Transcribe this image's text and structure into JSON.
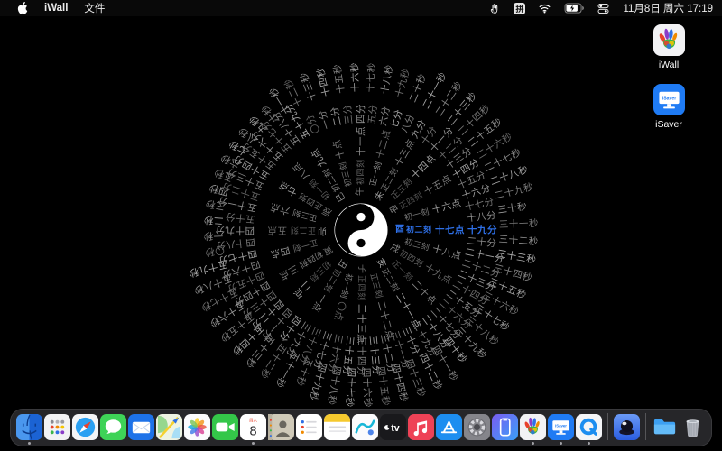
{
  "menubar": {
    "app_name": "iWall",
    "menus": [
      "文件"
    ],
    "input_badge": "拼",
    "datetime": "11月8日 周六 17:19",
    "status_icons": [
      "iwall-hand-icon",
      "input-source-badge",
      "wifi-icon",
      "battery-icon",
      "control-center-icon"
    ]
  },
  "desktop": {
    "icons": [
      {
        "id": "iwall",
        "label": "iWall"
      },
      {
        "id": "isaver",
        "label": "iSaver"
      }
    ]
  },
  "clock": {
    "highlight_color": "#2e6fe6",
    "dim_text_color": "#7a7a7a",
    "current": {
      "shichen_quarter": "酉初二刻",
      "hour": "十七点",
      "minute": "十九分",
      "second": "三十一秒"
    },
    "digits": [
      "〇",
      "一",
      "二",
      "三",
      "四",
      "五",
      "六",
      "七",
      "八",
      "九"
    ],
    "ten_char": "十",
    "zero_char": "〇",
    "zhi_ring": {
      "chars": [
        "子",
        "丑",
        "寅",
        "卯",
        "辰",
        "巳",
        "午",
        "未",
        "申",
        "酉",
        "戌",
        "亥"
      ],
      "current_index": 9,
      "radius": 38,
      "step_deg": 30,
      "font_size": 10
    },
    "quarter_ring": {
      "names": [
        "初一刻",
        "初二刻",
        "初三刻",
        "初四刻",
        "正一刻",
        "正二刻",
        "正三刻",
        "正四刻"
      ],
      "current_name_index": 1,
      "count": 24,
      "radius": 50,
      "step_deg": 15,
      "font_size": 9
    },
    "hour_ring": {
      "unit": "点",
      "count": 24,
      "current": 17,
      "radius": 82,
      "step_deg": 15,
      "font_size": 10.5
    },
    "minute_ring": {
      "unit": "分",
      "count": 60,
      "current": 19,
      "radius": 118,
      "step_deg": 6,
      "font_size": 10.5
    },
    "second_ring": {
      "unit": "秒",
      "count": 60,
      "current": 31,
      "radius": 153,
      "step_deg": 6,
      "offset_deg": -2,
      "font_size": 10.5
    }
  },
  "dock": {
    "items": [
      {
        "name": "finder",
        "running": true
      },
      {
        "name": "launchpad",
        "running": false
      },
      {
        "name": "safari",
        "running": false
      },
      {
        "name": "messages",
        "running": false
      },
      {
        "name": "mail",
        "running": false
      },
      {
        "name": "maps",
        "running": false
      },
      {
        "name": "photos",
        "running": false
      },
      {
        "name": "facetime",
        "running": false
      },
      {
        "name": "calendar",
        "running": true,
        "badge_top": "周六",
        "badge_day": "8"
      },
      {
        "name": "contacts",
        "running": false
      },
      {
        "name": "reminders",
        "running": false
      },
      {
        "name": "notes",
        "running": false
      },
      {
        "name": "freeform",
        "running": false
      },
      {
        "name": "appletv",
        "running": false
      },
      {
        "name": "music",
        "running": false
      },
      {
        "name": "appstore",
        "running": false
      },
      {
        "name": "settings",
        "running": false
      },
      {
        "name": "iphone-mirroring",
        "running": false
      },
      {
        "name": "iwall",
        "running": true
      },
      {
        "name": "isaver",
        "running": true
      },
      {
        "name": "quicktime",
        "running": true
      },
      {
        "divider": true
      },
      {
        "name": "ink-app",
        "running": false
      },
      {
        "divider": true
      },
      {
        "name": "downloads-folder",
        "running": false
      },
      {
        "name": "trash",
        "running": false
      }
    ]
  }
}
